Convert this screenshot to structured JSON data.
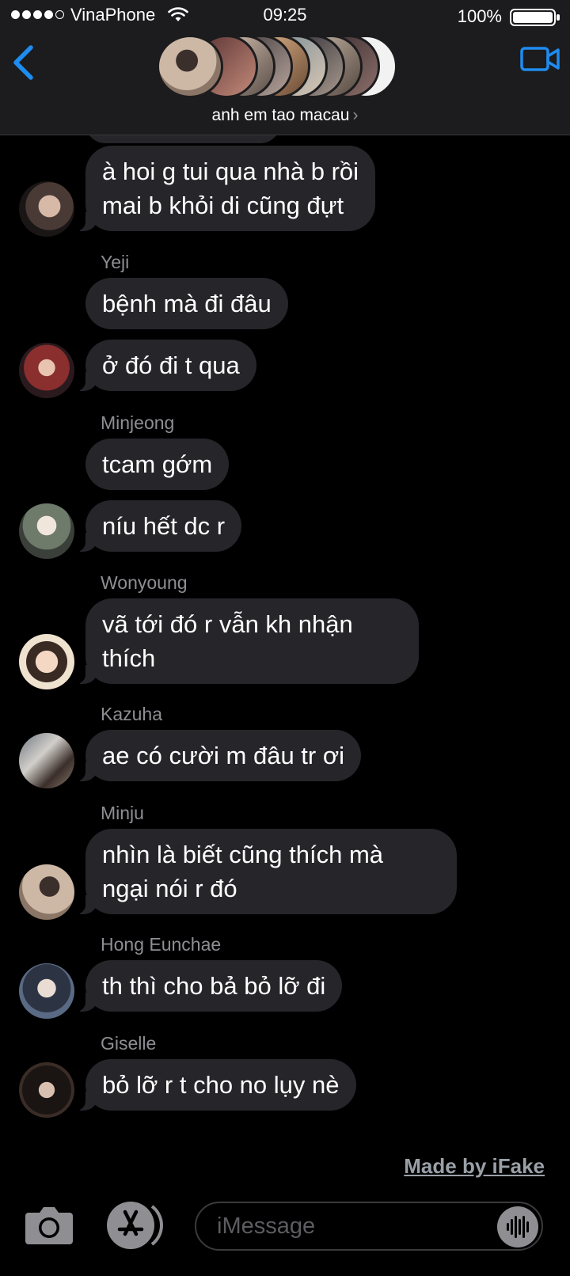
{
  "status_bar": {
    "carrier": "VinaPhone",
    "time": "09:25",
    "battery": "100%"
  },
  "header": {
    "group_name": "anh em tao macau",
    "chevron": "›",
    "back_icon": "chevron-left-icon",
    "video_icon": "video-camera-icon",
    "accent_color": "#1e8cf0"
  },
  "messages": [
    {
      "sender": "",
      "text_lines": [
        "à hoi g tui qua nhà b rồi",
        "mai b khỏi di cũng đựt"
      ]
    },
    {
      "sender": "Yeji",
      "text_lines": [
        "bệnh mà đi đâu"
      ]
    },
    {
      "sender": "",
      "text_lines": [
        "ở đó đi t qua"
      ]
    },
    {
      "sender": "Minjeong",
      "text_lines": [
        "tcam gớm"
      ]
    },
    {
      "sender": "",
      "text_lines": [
        "níu hết dc r"
      ]
    },
    {
      "sender": "Wonyoung",
      "text_lines": [
        "vã tới đó r vẫn kh nhận",
        "thích"
      ]
    },
    {
      "sender": "Kazuha",
      "text_lines": [
        "ae có cười m đâu tr ơi"
      ]
    },
    {
      "sender": "Minju",
      "text_lines": [
        "nhìn là biết cũng thích mà",
        "ngại nói r đó"
      ]
    },
    {
      "sender": "Hong Eunchae",
      "text_lines": [
        "th thì cho bả bỏ lỡ đi"
      ]
    },
    {
      "sender": "Giselle",
      "text_lines": [
        "bỏ lỡ r t cho no lụy nè"
      ]
    }
  ],
  "watermark": "Made by iFake",
  "input_bar": {
    "placeholder": "iMessage",
    "camera_icon": "camera-icon",
    "apps_icon": "app-store-icon",
    "audio_icon": "audio-waveform-icon"
  },
  "colors": {
    "bubble": "#26252a",
    "sender_label": "#8e8e93",
    "bar_background": "#1c1c1e"
  }
}
